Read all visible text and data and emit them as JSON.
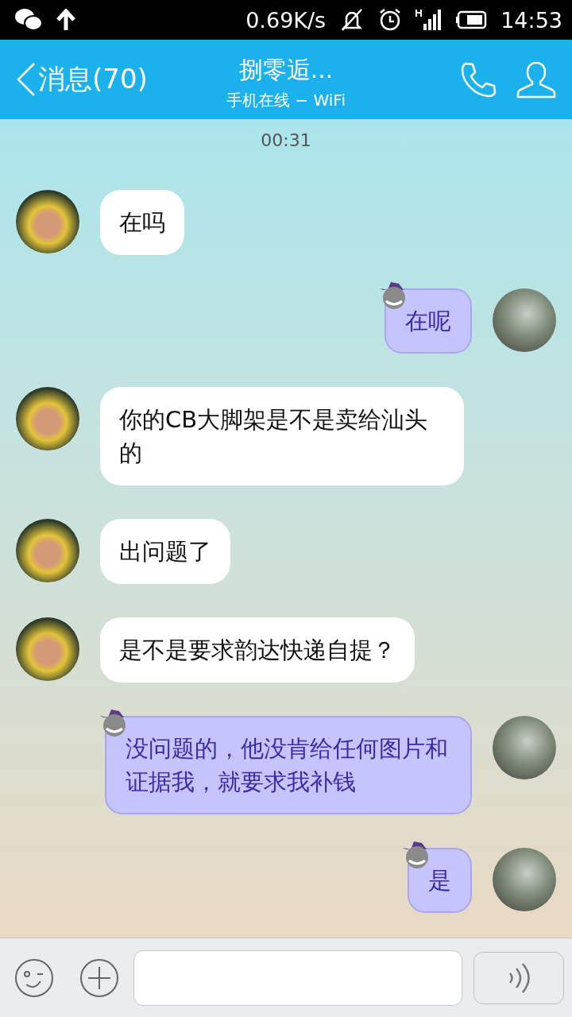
{
  "status_bar": {
    "speed": "0.69K/s",
    "time": "14:53"
  },
  "header": {
    "back_label": "消息(70)",
    "title": "捌零逅...",
    "subtitle": "手机在线 − WiFi"
  },
  "timestamp": "00:31",
  "messages": [
    {
      "kind": "incoming",
      "text": "在吗"
    },
    {
      "kind": "outgoing",
      "text": "在呢"
    },
    {
      "kind": "incoming",
      "text": "你的CB大脚架是不是卖给汕头的"
    },
    {
      "kind": "incoming",
      "text": "出问题了"
    },
    {
      "kind": "incoming",
      "text": "是不是要求韵达快递自提？"
    },
    {
      "kind": "outgoing",
      "text": "没问题的，他没肯给任何图片和证据我，就要求我补钱"
    },
    {
      "kind": "outgoing",
      "text": "是"
    }
  ]
}
